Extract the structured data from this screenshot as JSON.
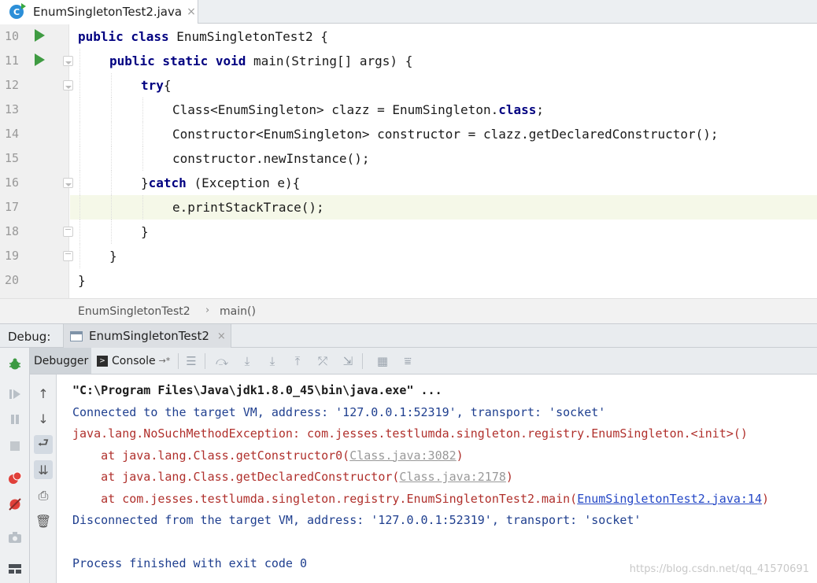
{
  "editor_tab": {
    "icon": "C",
    "filename": "EnumSingletonTest2.java",
    "close": "×"
  },
  "code_lines": [
    {
      "n": "10",
      "indent": 0,
      "segments": [
        {
          "t": "public class ",
          "k": true
        },
        {
          "t": "EnumSingletonTest2 {",
          "k": false
        }
      ]
    },
    {
      "n": "11",
      "indent": 1,
      "segments": [
        {
          "t": "public static void ",
          "k": true
        },
        {
          "t": "main(String[] args) {",
          "k": false
        }
      ]
    },
    {
      "n": "12",
      "indent": 2,
      "segments": [
        {
          "t": "try",
          "k": true
        },
        {
          "t": "{",
          "k": false
        }
      ]
    },
    {
      "n": "13",
      "indent": 3,
      "segments": [
        {
          "t": "Class<EnumSingleton> clazz = EnumSingleton.",
          "k": false
        },
        {
          "t": "class",
          "k": true
        },
        {
          "t": ";",
          "k": false
        }
      ]
    },
    {
      "n": "14",
      "indent": 3,
      "segments": [
        {
          "t": "Constructor<EnumSingleton> constructor = clazz.getDeclaredConstructor();",
          "k": false
        }
      ]
    },
    {
      "n": "15",
      "indent": 3,
      "segments": [
        {
          "t": "constructor.newInstance();",
          "k": false
        }
      ]
    },
    {
      "n": "16",
      "indent": 2,
      "segments": [
        {
          "t": "}",
          "k": false
        },
        {
          "t": "catch ",
          "k": true
        },
        {
          "t": "(Exception e){",
          "k": false
        }
      ]
    },
    {
      "n": "17",
      "indent": 3,
      "segments": [
        {
          "t": "e.printStackTrace();",
          "k": false
        }
      ]
    },
    {
      "n": "18",
      "indent": 2,
      "segments": [
        {
          "t": "}",
          "k": false
        }
      ]
    },
    {
      "n": "19",
      "indent": 1,
      "segments": [
        {
          "t": "}",
          "k": false
        }
      ]
    },
    {
      "n": "20",
      "indent": 0,
      "segments": [
        {
          "t": "}",
          "k": false
        }
      ]
    }
  ],
  "breadcrumb": {
    "class_name": "EnumSingletonTest2",
    "separator": "›",
    "method": "main()"
  },
  "debug": {
    "label": "Debug:",
    "session_tab": "EnumSingletonTest2",
    "session_close": "×",
    "subtabs": {
      "debugger": "Debugger",
      "console": "Console",
      "console_tag": ">",
      "pin": "→*"
    }
  },
  "console_lines": [
    {
      "cls": "cmd",
      "text": "\"C:\\Program Files\\Java\\jdk1.8.0_45\\bin\\java.exe\" ..."
    },
    {
      "cls": "info",
      "text": "Connected to the target VM, address: '127.0.0.1:52319', transport: 'socket'"
    },
    {
      "cls": "err",
      "text": "java.lang.NoSuchMethodException: com.jesses.testlumda.singleton.registry.EnumSingleton.<init>()"
    },
    {
      "cls": "err",
      "text": "    at java.lang.Class.getConstructor0(",
      "link": "Class.java:3082",
      "link_style": "g",
      "tail": ")"
    },
    {
      "cls": "err",
      "text": "    at java.lang.Class.getDeclaredConstructor(",
      "link": "Class.java:2178",
      "link_style": "g",
      "tail": ")"
    },
    {
      "cls": "err",
      "text": "    at com.jesses.testlumda.singleton.registry.EnumSingletonTest2.main(",
      "link": "EnumSingletonTest2.java:14",
      "link_style": "b",
      "tail": ")"
    },
    {
      "cls": "info",
      "text": "Disconnected from the target VM, address: '127.0.0.1:52319', transport: 'socket'"
    },
    {
      "cls": "info",
      "text": ""
    },
    {
      "cls": "info",
      "text": "Process finished with exit code 0"
    }
  ],
  "watermark": "https://blog.csdn.net/qq_41570691",
  "colors": {
    "keyword": "#000080",
    "error": "#b0302c",
    "info": "#1f3f8f",
    "run": "#3f9b42"
  }
}
